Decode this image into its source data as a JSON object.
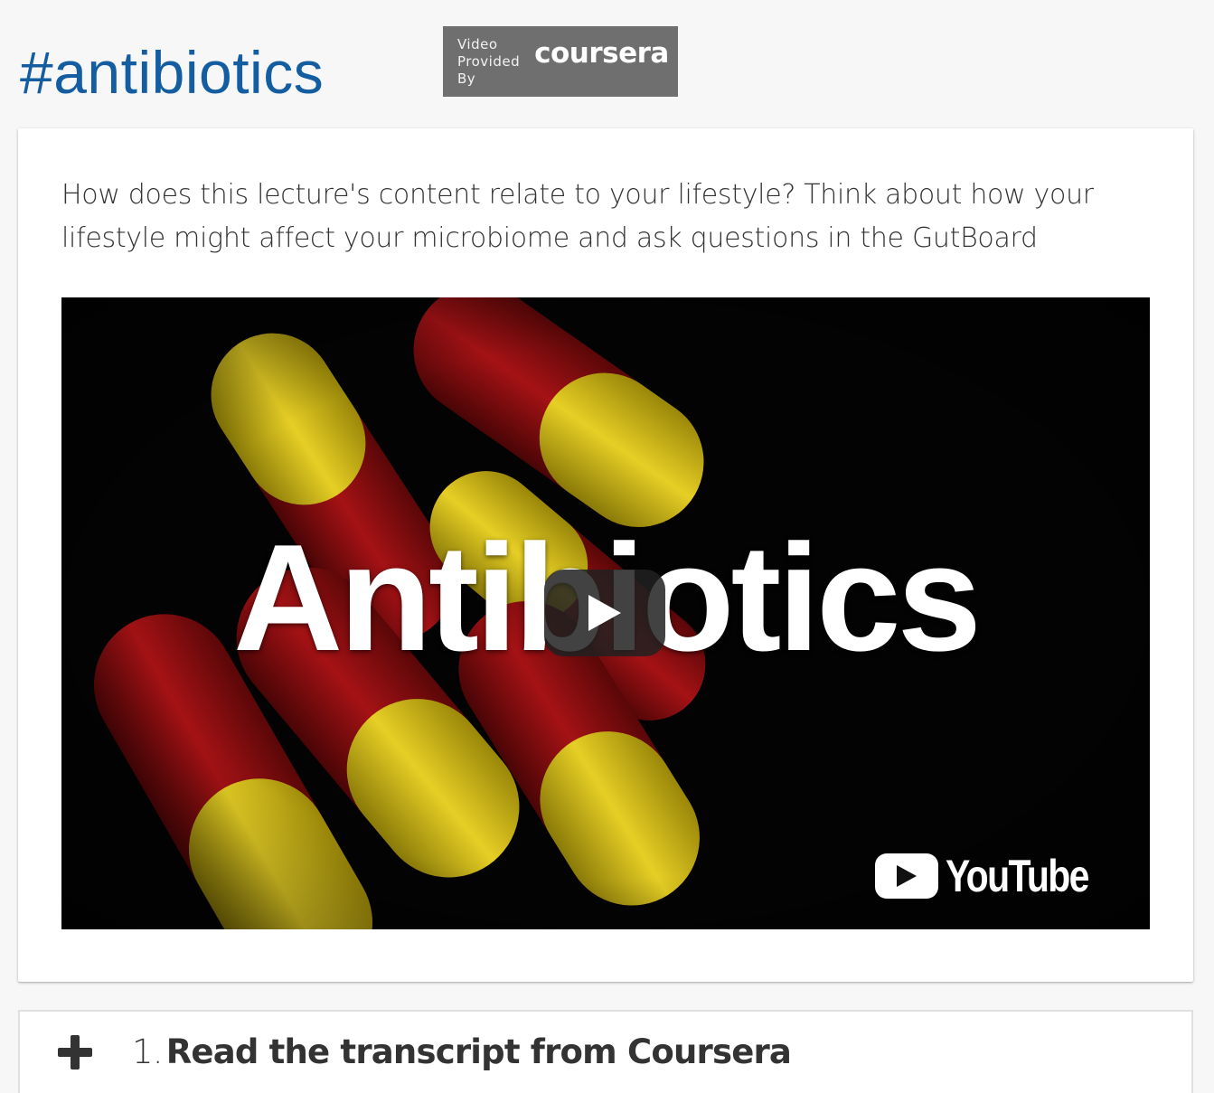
{
  "header": {
    "hashtag": "#antibiotics",
    "badge": {
      "lines": [
        "Video",
        "Provided",
        "By"
      ],
      "brand": "coursera"
    }
  },
  "card": {
    "prompt": "How does this lecture's content relate to your lifestyle? Think about how your lifestyle might affect your microbiome and ask questions in the GutBoard",
    "video": {
      "thumbnail_title": "Antibiotics",
      "play_icon": "play-icon",
      "provider_logo": "YouTube"
    }
  },
  "accordion": {
    "icon": "plus-icon",
    "number": "1.",
    "label": "Read the transcript from Coursera"
  },
  "colors": {
    "title_blue": "#135da0",
    "badge_gray": "#6f6f6f",
    "capsule_yellow": "#d9c21a",
    "capsule_red": "#8e0f10"
  }
}
